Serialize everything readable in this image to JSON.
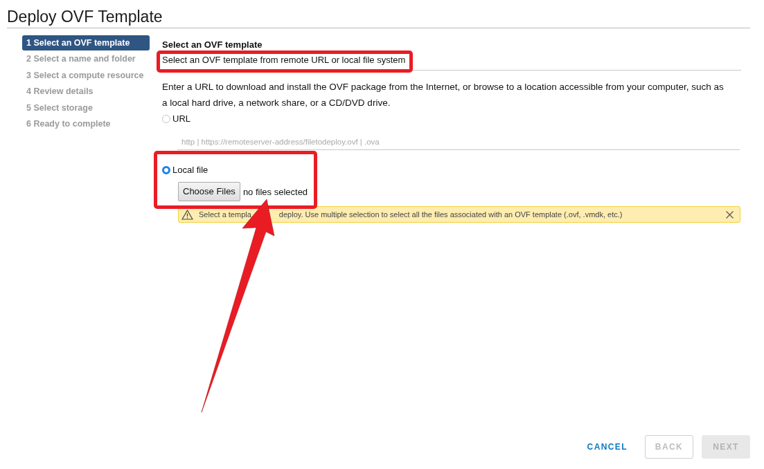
{
  "window": {
    "title": "Deploy OVF Template"
  },
  "steps": [
    {
      "label": "1 Select an OVF template",
      "selected": true
    },
    {
      "label": "2 Select a name and folder",
      "selected": false
    },
    {
      "label": "3 Select a compute resource",
      "selected": false
    },
    {
      "label": "4 Review details",
      "selected": false
    },
    {
      "label": "5 Select storage",
      "selected": false
    },
    {
      "label": "6 Ready to complete",
      "selected": false
    }
  ],
  "page": {
    "heading": "Select an OVF template",
    "subtitle": "Select an OVF template from remote URL or local file system",
    "highlighted": true,
    "description": "Enter a URL to download and install the OVF package from the Internet, or browse to a location accessible from your computer, such as a local hard drive, a network share, or a CD/DVD drive."
  },
  "source_options": [
    {
      "kind": "url",
      "label": "URL",
      "selected": false,
      "placeholder": "http | https://remoteserver-address/filetodeploy.ovf | .ova"
    },
    {
      "kind": "local_file",
      "label": "Local file",
      "selected": true,
      "highlighted": true,
      "pointer_arrow": true,
      "button": "Choose Files",
      "file_status": "no files selected"
    }
  ],
  "alert": {
    "message_parts": [
      "Select a templa",
      "deploy. Use multiple selection to select all the files associated with an OVF template (.ovf, .vmdk, etc.)"
    ]
  },
  "buttons": [
    {
      "kind": "link",
      "label": "CANCEL",
      "disabled": false
    },
    {
      "kind": "outline",
      "label": "BACK",
      "disabled": true
    },
    {
      "kind": "solid",
      "label": "NEXT",
      "disabled": true
    }
  ]
}
